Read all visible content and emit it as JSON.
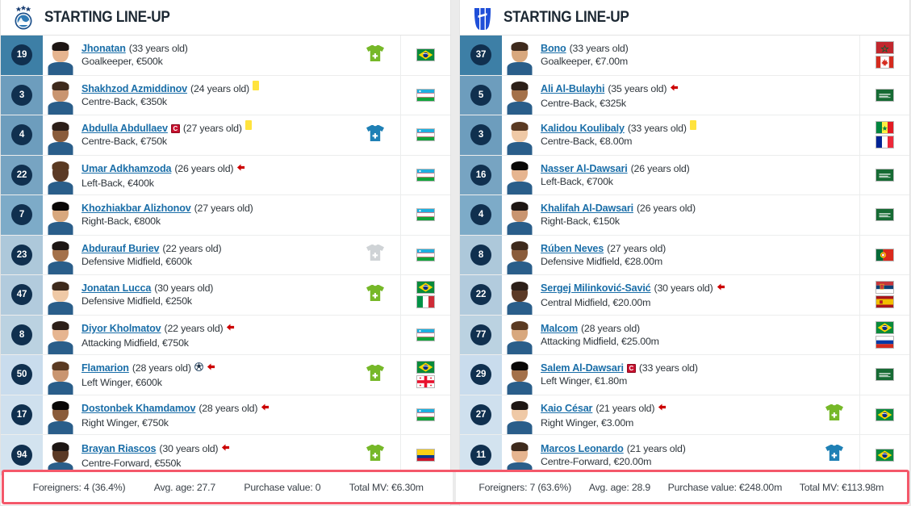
{
  "colors": {
    "name_link": "#1a6ea8",
    "number_badge": "#10304f",
    "footer_border": "#f4586a",
    "sub_in_green": "#76b828",
    "sub_out_blue": "#1f80b5",
    "sub_muted_grey": "#cfd3d6",
    "yellow_card": "#ffe33d",
    "captain_red": "#c8102e",
    "arrow_red": "#cc0000"
  },
  "panels": [
    {
      "id": "left",
      "crest_icon": "pakhtakor-crest-icon",
      "title": "STARTING LINE-UP",
      "players": [
        {
          "number": "19",
          "name": "Jhonatan",
          "age_text": "(33 years old)",
          "position_value": "Goalkeeper, €500k",
          "captain": false,
          "yellow_card": false,
          "goal": false,
          "sub_off_arrow": false,
          "sub_icon": "jersey-plus-green-icon",
          "flags": [
            "brazil"
          ],
          "row_shade": "#3d7fa6"
        },
        {
          "number": "3",
          "name": "Shakhzod Azmiddinov",
          "age_text": "(24 years old)",
          "position_value": "Centre-Back, €350k",
          "captain": false,
          "yellow_card": true,
          "goal": false,
          "sub_off_arrow": false,
          "sub_icon": "none",
          "flags": [
            "uzbekistan"
          ],
          "row_shade": "#6d9dbd"
        },
        {
          "number": "4",
          "name": "Abdulla Abdullaev",
          "age_text": "(27 years old)",
          "position_value": "Centre-Back, €750k",
          "captain": true,
          "yellow_card": true,
          "goal": false,
          "sub_off_arrow": false,
          "sub_icon": "jersey-plus-blue-icon",
          "flags": [
            "uzbekistan"
          ],
          "row_shade": "#6d9dbd"
        },
        {
          "number": "22",
          "name": "Umar Adkhamzoda",
          "age_text": "(26 years old)",
          "position_value": "Left-Back, €400k",
          "captain": false,
          "yellow_card": false,
          "goal": false,
          "sub_off_arrow": true,
          "sub_icon": "none",
          "flags": [
            "uzbekistan"
          ],
          "row_shade": "#77a4c2"
        },
        {
          "number": "7",
          "name": "Khozhiakbar Alizhonov",
          "age_text": "(27 years old)",
          "position_value": "Right-Back, €800k",
          "captain": false,
          "yellow_card": false,
          "goal": false,
          "sub_off_arrow": false,
          "sub_icon": "none",
          "flags": [
            "uzbekistan"
          ],
          "row_shade": "#7dabc8"
        },
        {
          "number": "23",
          "name": "Abdurauf Buriev",
          "age_text": "(22 years old)",
          "position_value": "Defensive Midfield, €600k",
          "captain": false,
          "yellow_card": false,
          "goal": false,
          "sub_off_arrow": false,
          "sub_icon": "jersey-plus-grey-icon",
          "flags": [
            "uzbekistan"
          ],
          "row_shade": "#adc8da"
        },
        {
          "number": "47",
          "name": "Jonatan Lucca",
          "age_text": "(30 years old)",
          "position_value": "Defensive Midfield, €250k",
          "captain": false,
          "yellow_card": false,
          "goal": false,
          "sub_off_arrow": false,
          "sub_icon": "jersey-plus-green-icon",
          "flags": [
            "brazil",
            "italy"
          ],
          "row_shade": "#b2cbdd"
        },
        {
          "number": "8",
          "name": "Diyor Kholmatov",
          "age_text": "(22 years old)",
          "position_value": "Attacking Midfield, €750k",
          "captain": false,
          "yellow_card": false,
          "goal": false,
          "sub_off_arrow": true,
          "sub_icon": "none",
          "flags": [
            "uzbekistan"
          ],
          "row_shade": "#bbd2e1"
        },
        {
          "number": "50",
          "name": "Flamarion",
          "age_text": "(28 years old)",
          "position_value": "Left Winger, €600k",
          "captain": false,
          "yellow_card": false,
          "goal": true,
          "sub_off_arrow": true,
          "sub_icon": "jersey-plus-green-icon",
          "flags": [
            "brazil",
            "georgia"
          ],
          "row_shade": "#c9dced"
        },
        {
          "number": "17",
          "name": "Dostonbek Khamdamov",
          "age_text": "(28 years old)",
          "position_value": "Right Winger, €750k",
          "captain": false,
          "yellow_card": false,
          "goal": false,
          "sub_off_arrow": true,
          "sub_icon": "none",
          "flags": [
            "uzbekistan"
          ],
          "row_shade": "#cfe0ee"
        },
        {
          "number": "94",
          "name": "Brayan Riascos",
          "age_text": "(30 years old)",
          "position_value": "Centre-Forward, €550k",
          "captain": false,
          "yellow_card": false,
          "goal": false,
          "sub_off_arrow": true,
          "sub_icon": "jersey-plus-green-icon",
          "flags": [
            "colombia"
          ],
          "row_shade": "#d3e3ef"
        }
      ],
      "stats": [
        "Foreigners: 4 (36.4%)",
        "Avg. age: 27.7",
        "Purchase value: 0",
        "Total MV: €6.30m"
      ]
    },
    {
      "id": "right",
      "crest_icon": "al-hilal-crest-icon",
      "title": "STARTING LINE-UP",
      "players": [
        {
          "number": "37",
          "name": "Bono",
          "age_text": "(33 years old)",
          "position_value": "Goalkeeper, €7.00m",
          "captain": false,
          "yellow_card": false,
          "goal": false,
          "sub_off_arrow": false,
          "sub_icon": "none",
          "flags": [
            "morocco",
            "canada"
          ],
          "row_shade": "#3d7fa6"
        },
        {
          "number": "5",
          "name": "Ali Al-Bulayhi",
          "age_text": "(35 years old)",
          "position_value": "Centre-Back, €325k",
          "captain": false,
          "yellow_card": false,
          "goal": false,
          "sub_off_arrow": true,
          "sub_icon": "none",
          "flags": [
            "saudi"
          ],
          "row_shade": "#6d9dbd"
        },
        {
          "number": "3",
          "name": "Kalidou Koulibaly",
          "age_text": "(33 years old)",
          "position_value": "Centre-Back, €8.00m",
          "captain": false,
          "yellow_card": true,
          "goal": false,
          "sub_off_arrow": false,
          "sub_icon": "none",
          "flags": [
            "senegal",
            "france"
          ],
          "row_shade": "#6d9dbd"
        },
        {
          "number": "16",
          "name": "Nasser Al-Dawsari",
          "age_text": "(26 years old)",
          "position_value": "Left-Back, €700k",
          "captain": false,
          "yellow_card": false,
          "goal": false,
          "sub_off_arrow": false,
          "sub_icon": "none",
          "flags": [
            "saudi"
          ],
          "row_shade": "#77a4c2"
        },
        {
          "number": "4",
          "name": "Khalifah Al-Dawsari",
          "age_text": "(26 years old)",
          "position_value": "Right-Back, €150k",
          "captain": false,
          "yellow_card": false,
          "goal": false,
          "sub_off_arrow": false,
          "sub_icon": "none",
          "flags": [
            "saudi"
          ],
          "row_shade": "#7dabc8"
        },
        {
          "number": "8",
          "name": "Rúben Neves",
          "age_text": "(27 years old)",
          "position_value": "Defensive Midfield, €28.00m",
          "captain": false,
          "yellow_card": false,
          "goal": false,
          "sub_off_arrow": false,
          "sub_icon": "none",
          "flags": [
            "portugal"
          ],
          "row_shade": "#adc8da"
        },
        {
          "number": "22",
          "name": "Sergej Milinković-Savić",
          "age_text": "(30 years old)",
          "position_value": "Central Midfield, €20.00m",
          "captain": false,
          "yellow_card": false,
          "goal": false,
          "sub_off_arrow": true,
          "sub_icon": "none",
          "flags": [
            "serbia",
            "spain"
          ],
          "row_shade": "#b2cbdd"
        },
        {
          "number": "77",
          "name": "Malcom",
          "age_text": "(28 years old)",
          "position_value": "Attacking Midfield, €25.00m",
          "captain": false,
          "yellow_card": false,
          "goal": false,
          "sub_off_arrow": false,
          "sub_icon": "none",
          "flags": [
            "brazil",
            "russia"
          ],
          "row_shade": "#bbd2e1"
        },
        {
          "number": "29",
          "name": "Salem Al-Dawsari",
          "age_text": "(33 years old)",
          "position_value": "Left Winger, €1.80m",
          "captain": true,
          "yellow_card": false,
          "goal": false,
          "sub_off_arrow": false,
          "sub_icon": "none",
          "flags": [
            "saudi"
          ],
          "row_shade": "#c9dced"
        },
        {
          "number": "27",
          "name": "Kaio César",
          "age_text": "(21 years old)",
          "position_value": "Right Winger, €3.00m",
          "captain": false,
          "yellow_card": false,
          "goal": false,
          "sub_off_arrow": true,
          "sub_icon": "jersey-plus-green-icon",
          "flags": [
            "brazil"
          ],
          "row_shade": "#cfe0ee"
        },
        {
          "number": "11",
          "name": "Marcos Leonardo",
          "age_text": "(21 years old)",
          "position_value": "Centre-Forward, €20.00m",
          "captain": false,
          "yellow_card": false,
          "goal": false,
          "sub_off_arrow": false,
          "sub_icon": "jersey-plus-blue-icon",
          "flags": [
            "brazil"
          ],
          "row_shade": "#d3e3ef"
        }
      ],
      "stats": [
        "Foreigners: 7 (63.6%)",
        "Avg. age: 28.9",
        "Purchase value: €248.00m",
        "Total MV: €113.98m"
      ]
    }
  ]
}
